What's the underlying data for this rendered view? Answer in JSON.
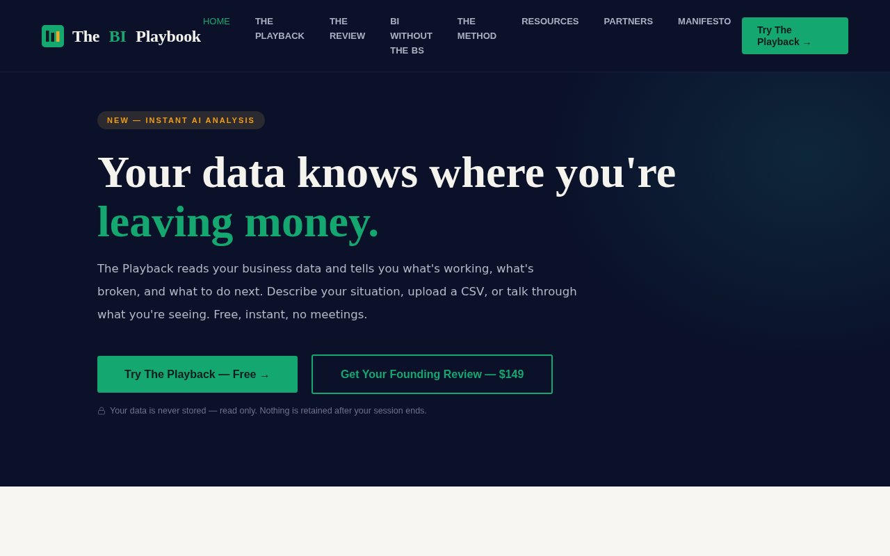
{
  "header": {
    "logo": {
      "parts": [
        {
          "text": "The",
          "accent": false
        },
        {
          "text": "BI",
          "accent": true
        },
        {
          "text": "Playbook",
          "accent": false
        }
      ]
    },
    "nav": [
      {
        "label": "HOME",
        "selected": true
      },
      {
        "label": "THE PLAYBACK",
        "selected": false
      },
      {
        "label": "THE REVIEW",
        "selected": false
      },
      {
        "label": "BI WITHOUT THE BS",
        "selected": false
      },
      {
        "label": "THE METHOD",
        "selected": false
      },
      {
        "label": "RESOURCES",
        "selected": false
      },
      {
        "label": "PARTNERS",
        "selected": false
      },
      {
        "label": "MANIFESTO",
        "selected": false
      }
    ],
    "cta": "Try The Playback →"
  },
  "hero": {
    "badge": "NEW — INSTANT AI ANALYSIS",
    "headline": [
      {
        "text": "Your data knows where you're",
        "accent": false
      },
      {
        "text": "leaving money.",
        "accent": true
      }
    ],
    "description": "The Playback reads your business data and tells you what's working, what's broken, and what to do next. Describe your situation, upload a CSV, or talk through what you're seeing. Free, instant, no meetings.",
    "buttons": [
      {
        "label": "Try The Playback — Free →",
        "kind": "primary"
      },
      {
        "label": "Get Your Founding Review — $149",
        "kind": "outline"
      }
    ],
    "note": "Your data is never stored — read only. Nothing is retained after your session ends."
  }
}
